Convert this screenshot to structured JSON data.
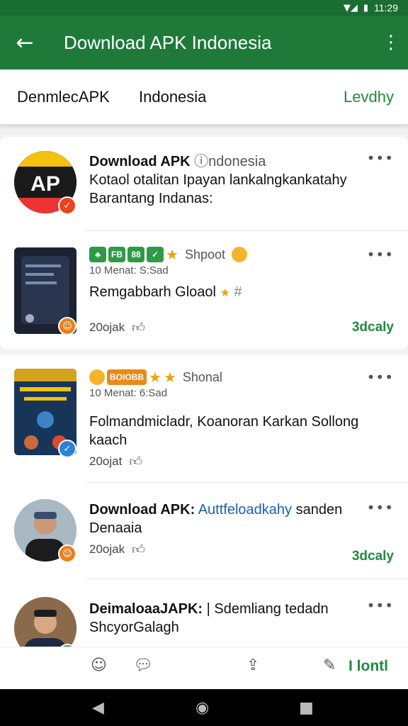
{
  "status_bar": {
    "time": "11:29"
  },
  "app_bar": {
    "title": "Download APK Indonesia"
  },
  "tabs": [
    "DenmlecAPK",
    "Indonesia",
    "Levdhy"
  ],
  "posts": [
    {
      "title_bold": "Download APK",
      "title_light": "ndonesia",
      "desc_line1": "Kotaol otalitan Ipayan lankalngkankatahy",
      "desc_line2": "Barantang Indanas:"
    },
    {
      "chip_texts": [
        "FB",
        "88"
      ],
      "chip_label": "Shpoot",
      "meta": "10 Menat: S:Sad",
      "title": "Remgabbarh Gloaol",
      "time": "20ojak",
      "action": "3dcaly"
    },
    {
      "chip_texts": [
        "BOIOBB"
      ],
      "chip_label": "Shonal",
      "meta": "10 Menat: 6:Sad",
      "desc_line1": "Folmandmicladr, Koanoran Karkan Sollong",
      "desc_line2": "kaach",
      "time": "20ojat"
    },
    {
      "title_bold": "Download APK:",
      "title_link": "Auttfeloadkahy",
      "title_rest": "sanden",
      "desc_line1": "Denaaia",
      "time": "20ojak",
      "action": "3dcaly"
    },
    {
      "title_bold": "DeimaloaaJAPK:",
      "title_rest": "| Sdemliang tedadn",
      "desc_line1": "ShcyorGalagh"
    }
  ],
  "bottom_action": {
    "label": "I lontl"
  },
  "icons": {
    "back": "arrow-left-icon",
    "more": "more-vert-icon",
    "like": "thumbs-up-icon",
    "share": "share-icon",
    "comment": "comment-icon",
    "edit": "edit-icon"
  },
  "colors": {
    "primary": "#1f7a3a",
    "accent": "#1f8a3e",
    "status": "#1a6e32"
  }
}
